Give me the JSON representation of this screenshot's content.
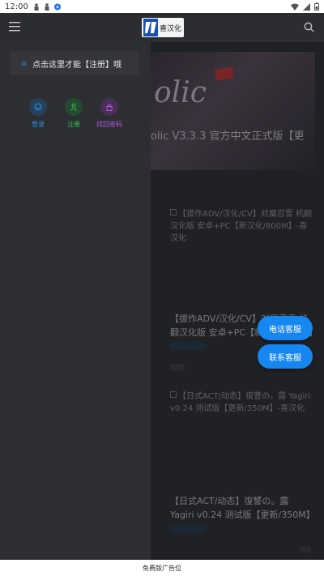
{
  "status_bar": {
    "time": "12:00"
  },
  "header": {
    "logo_text": "喜汉化"
  },
  "feed": {
    "hero_title": "olic V3.3.3 官方中文正式版【更",
    "items": [
      {
        "thumb_title": "【拔作ADV/汉化/CV】对魔忍雪 机翻汉化版 安卓+PC【新汉化/800M】-喜汉化",
        "title": "【拔作ADV/汉化/CV】对魔忍雪 机翻汉化版 安卓+PC【新汉化/800M】"
      },
      {
        "thumb_title": "【日式ACT/动态】復讐の。露 Yagiri v0.24 测试版【更新/350M】-喜汉化",
        "title": "【日式ACT/动态】復讐の。露 Yagiri v0.24 测试版【更新/350M】"
      }
    ]
  },
  "drawer": {
    "notice": "点击这里才能【注册】哦",
    "actions": [
      {
        "label": "登录",
        "icon": "smile-icon",
        "color": "#2f93e8"
      },
      {
        "label": "注册",
        "icon": "user-icon",
        "color": "#35c24a"
      },
      {
        "label": "找回密码",
        "icon": "lock-icon",
        "color": "#b05be0"
      }
    ]
  },
  "fabs": {
    "phone": "电话客服",
    "contact": "联系客服"
  },
  "ad_bar": "免费版广告位"
}
